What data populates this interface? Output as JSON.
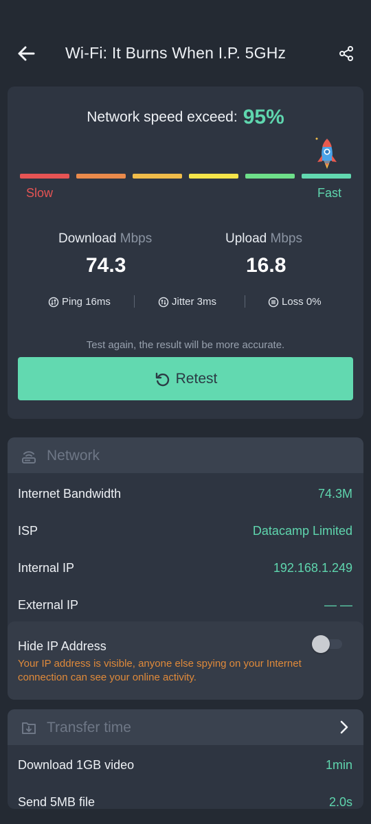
{
  "header": {
    "title": "Wi-Fi: It Burns When I.P. 5GHz",
    "back_icon": "arrow-left-icon",
    "share_icon": "share-icon"
  },
  "speed": {
    "exceed_label": "Network speed exceed:",
    "exceed_percent": "95%",
    "slow_label": "Slow",
    "fast_label": "Fast",
    "gauge_colors": [
      "#e65454",
      "#ea8a4b",
      "#f0bc4a",
      "#f5e54a",
      "#6ee08a",
      "#62d9b0"
    ],
    "gauge_level": 0.95,
    "download": {
      "label": "Download",
      "unit": "Mbps",
      "value": "74.3"
    },
    "upload": {
      "label": "Upload",
      "unit": "Mbps",
      "value": "16.8"
    },
    "ping": "Ping 16ms",
    "jitter": "Jitter 3ms",
    "loss": "Loss 0%",
    "hint": "Test again, the result will be more accurate.",
    "retest_label": "Retest"
  },
  "network": {
    "title": "Network",
    "rows": [
      {
        "label": "Internet Bandwidth",
        "value": "74.3M"
      },
      {
        "label": "ISP",
        "value": "Datacamp Limited"
      },
      {
        "label": "Internal IP",
        "value": "192.168.1.249"
      },
      {
        "label": "External IP",
        "value": "— —"
      }
    ],
    "hide_ip": {
      "title": "Hide IP Address",
      "enabled": false,
      "description": "Your IP address is visible, anyone else spying on your Internet connection can see your online activity."
    }
  },
  "transfer": {
    "title": "Transfer time",
    "rows": [
      {
        "label": "Download 1GB video",
        "value": "1min"
      },
      {
        "label": "Send 5MB file",
        "value": "2.0s"
      }
    ]
  },
  "colors": {
    "background": "#242a33",
    "card": "#2e3541",
    "accent": "#5fd6ae",
    "warning": "#e08a3a"
  }
}
